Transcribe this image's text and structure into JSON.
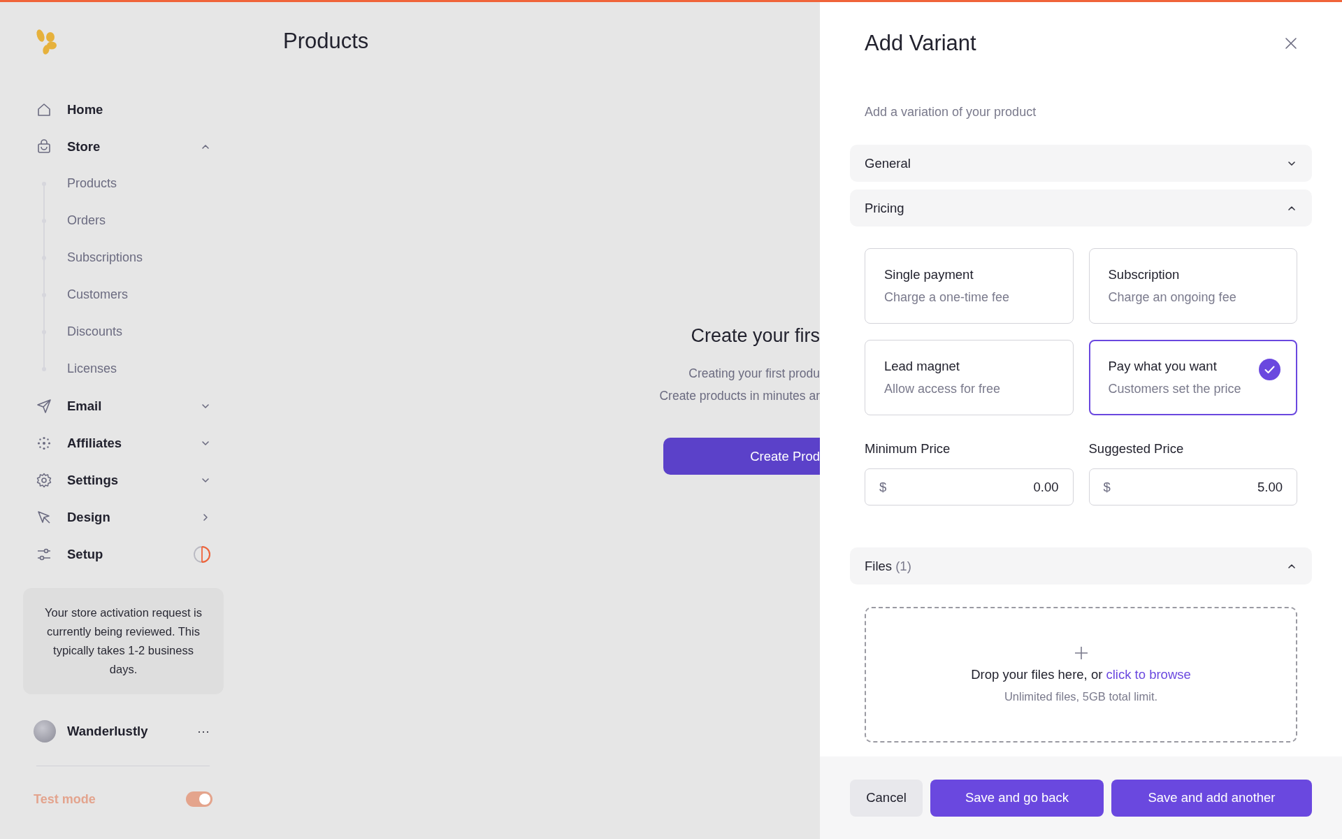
{
  "page_title": "Products",
  "nav": [
    {
      "label": "Home",
      "kind": "plain"
    },
    {
      "label": "Store",
      "kind": "group",
      "expanded": true,
      "children": [
        {
          "label": "Products"
        },
        {
          "label": "Orders"
        },
        {
          "label": "Subscriptions"
        },
        {
          "label": "Customers"
        },
        {
          "label": "Discounts"
        },
        {
          "label": "Licenses"
        }
      ]
    },
    {
      "label": "Email",
      "kind": "group",
      "expanded": false
    },
    {
      "label": "Affiliates",
      "kind": "group",
      "expanded": false
    },
    {
      "label": "Settings",
      "kind": "group",
      "expanded": false
    },
    {
      "label": "Design",
      "kind": "link"
    },
    {
      "label": "Setup",
      "kind": "progress",
      "level": 0.5
    }
  ],
  "notice": "Your store activation request is currently being reviewed. This typically takes 1-2 business days.",
  "user": {
    "name": "Wanderlustly",
    "menu": "···"
  },
  "test_mode": {
    "label": "Test mode",
    "on": true
  },
  "empty_state": {
    "title": "Create your firs",
    "lines": [
      "Creating your first produ",
      "Create products in minutes ar"
    ],
    "button": "Create Prod"
  },
  "panel": {
    "title": "Add Variant",
    "subtitle": "Add a variation of your product",
    "sections": [
      {
        "title": "General",
        "expanded": false
      },
      {
        "title": "Pricing",
        "expanded": true
      }
    ],
    "pricing_options": [
      {
        "title": "Single payment",
        "description": "Charge a one-time fee",
        "selected": false
      },
      {
        "title": "Subscription",
        "description": "Charge an ongoing fee",
        "selected": false
      },
      {
        "title": "Lead magnet",
        "description": "Allow access for free",
        "selected": false
      },
      {
        "title": "Pay what you want",
        "description": "Customers set the price",
        "selected": true
      }
    ],
    "price_fields": [
      {
        "label": "Minimum Price",
        "currency": "$",
        "value": "0.00"
      },
      {
        "label": "Suggested Price",
        "currency": "$",
        "value": "5.00"
      }
    ],
    "files": {
      "title": "Files",
      "count": "(1)",
      "expanded": true
    },
    "dropzone": {
      "text": "Drop your files here, or",
      "link": "click to browse",
      "hint": "Unlimited files, 5GB total limit."
    },
    "buttons": [
      {
        "label": "Cancel",
        "kind": "secondary"
      },
      {
        "label": "Save and go back",
        "kind": "primary"
      },
      {
        "label": "Save and add another",
        "kind": "primary"
      }
    ]
  }
}
